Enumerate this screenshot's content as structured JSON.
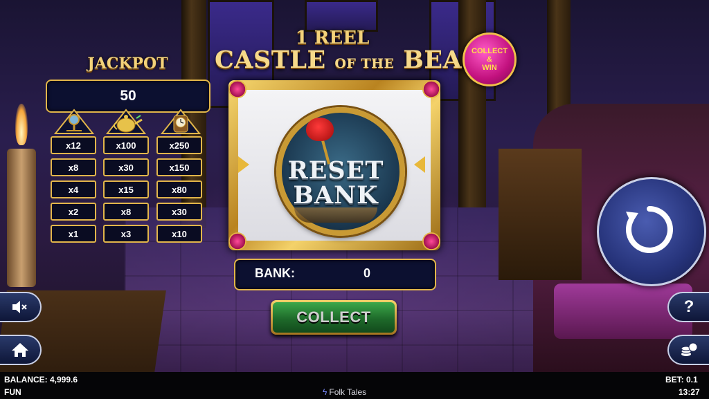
{
  "title": {
    "line1": "1 REEL",
    "line2_part1": "CASTLE",
    "line2_part2": "OF THE",
    "line2_part3": "BEAST"
  },
  "badge": {
    "line1": "COLLECT",
    "line2": "&",
    "line3": "WIN"
  },
  "jackpot": {
    "label": "JACKPOT",
    "value": "50",
    "columns": [
      {
        "icon": "mirror-icon",
        "multipliers": [
          "x12",
          "x8",
          "x4",
          "x2",
          "x1"
        ]
      },
      {
        "icon": "teapot-icon",
        "multipliers": [
          "x100",
          "x30",
          "x15",
          "x8",
          "x3"
        ]
      },
      {
        "icon": "clock-icon",
        "multipliers": [
          "x250",
          "x150",
          "x80",
          "x30",
          "x10"
        ]
      }
    ]
  },
  "reel": {
    "symbol_line1": "RESET",
    "symbol_line2": "BANK"
  },
  "bank": {
    "label": "BANK:",
    "value": "0"
  },
  "collect_button": "COLLECT",
  "controls": {
    "sound": "mute-speaker-icon",
    "home": "home-icon",
    "help": "?",
    "bet": "coin-stack-icon",
    "spin": "spin-icon"
  },
  "status": {
    "balance": "BALANCE: 4,999.6",
    "mode": "FUN",
    "game_name": "Folk Tales",
    "bet": "BET: 0.1",
    "time": "13:27"
  },
  "colors": {
    "gold": "#e2b64a",
    "panel": "#0c1030",
    "collect_green": "#2a8a3a",
    "badge_pink": "#c2117e",
    "spin_blue": "#26337a"
  }
}
